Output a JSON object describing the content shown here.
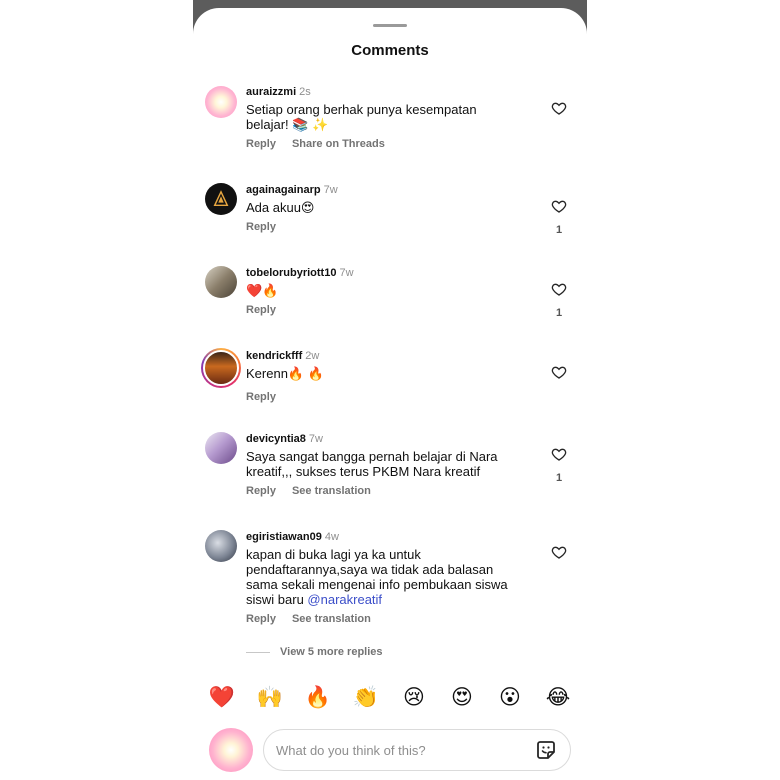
{
  "sheet": {
    "title": "Comments"
  },
  "comments": [
    {
      "username": "auraizzmi",
      "time": "2s",
      "text": "Setiap orang berhak punya kesempatan\nbelajar! 📚 ✨",
      "actions": [
        "Reply",
        "Share on Threads"
      ],
      "likes": ""
    },
    {
      "username": "againagainarp",
      "time": "7w",
      "text": "Ada akuu😍",
      "actions": [
        "Reply"
      ],
      "likes": "1"
    },
    {
      "username": "tobelorubyriott10",
      "time": "7w",
      "text": "❤️🔥",
      "actions": [
        "Reply"
      ],
      "likes": "1"
    },
    {
      "username": "kendrickfff",
      "time": "2w",
      "text": "Kerenn🔥 🔥",
      "actions": [
        "Reply"
      ],
      "likes": ""
    },
    {
      "username": "devicyntia8",
      "time": "7w",
      "text": "Saya sangat bangga pernah belajar di Nara\nkreatif,,, sukses terus PKBM Nara kreatif",
      "actions": [
        "Reply",
        "See translation"
      ],
      "likes": "1"
    },
    {
      "username": "egiristiawan09",
      "time": "4w",
      "text": "kapan di buka lagi ya ka untuk\npendaftarannya,saya wa tidak ada balasan\nsama sekali mengenai info pembukaan siswa\nsiswi baru ",
      "mention": "@narakreatif",
      "actions": [
        "Reply",
        "See translation"
      ],
      "likes": ""
    }
  ],
  "view_more": "View 5 more replies",
  "quick_reactions": [
    "❤️",
    "🙌",
    "🔥",
    "👏",
    "😢",
    "😍",
    "😮",
    "😂"
  ],
  "composer": {
    "placeholder": "What do you think of this?"
  },
  "icons": {
    "like": "heart-outline-icon",
    "sticker": "sticker-icon"
  }
}
